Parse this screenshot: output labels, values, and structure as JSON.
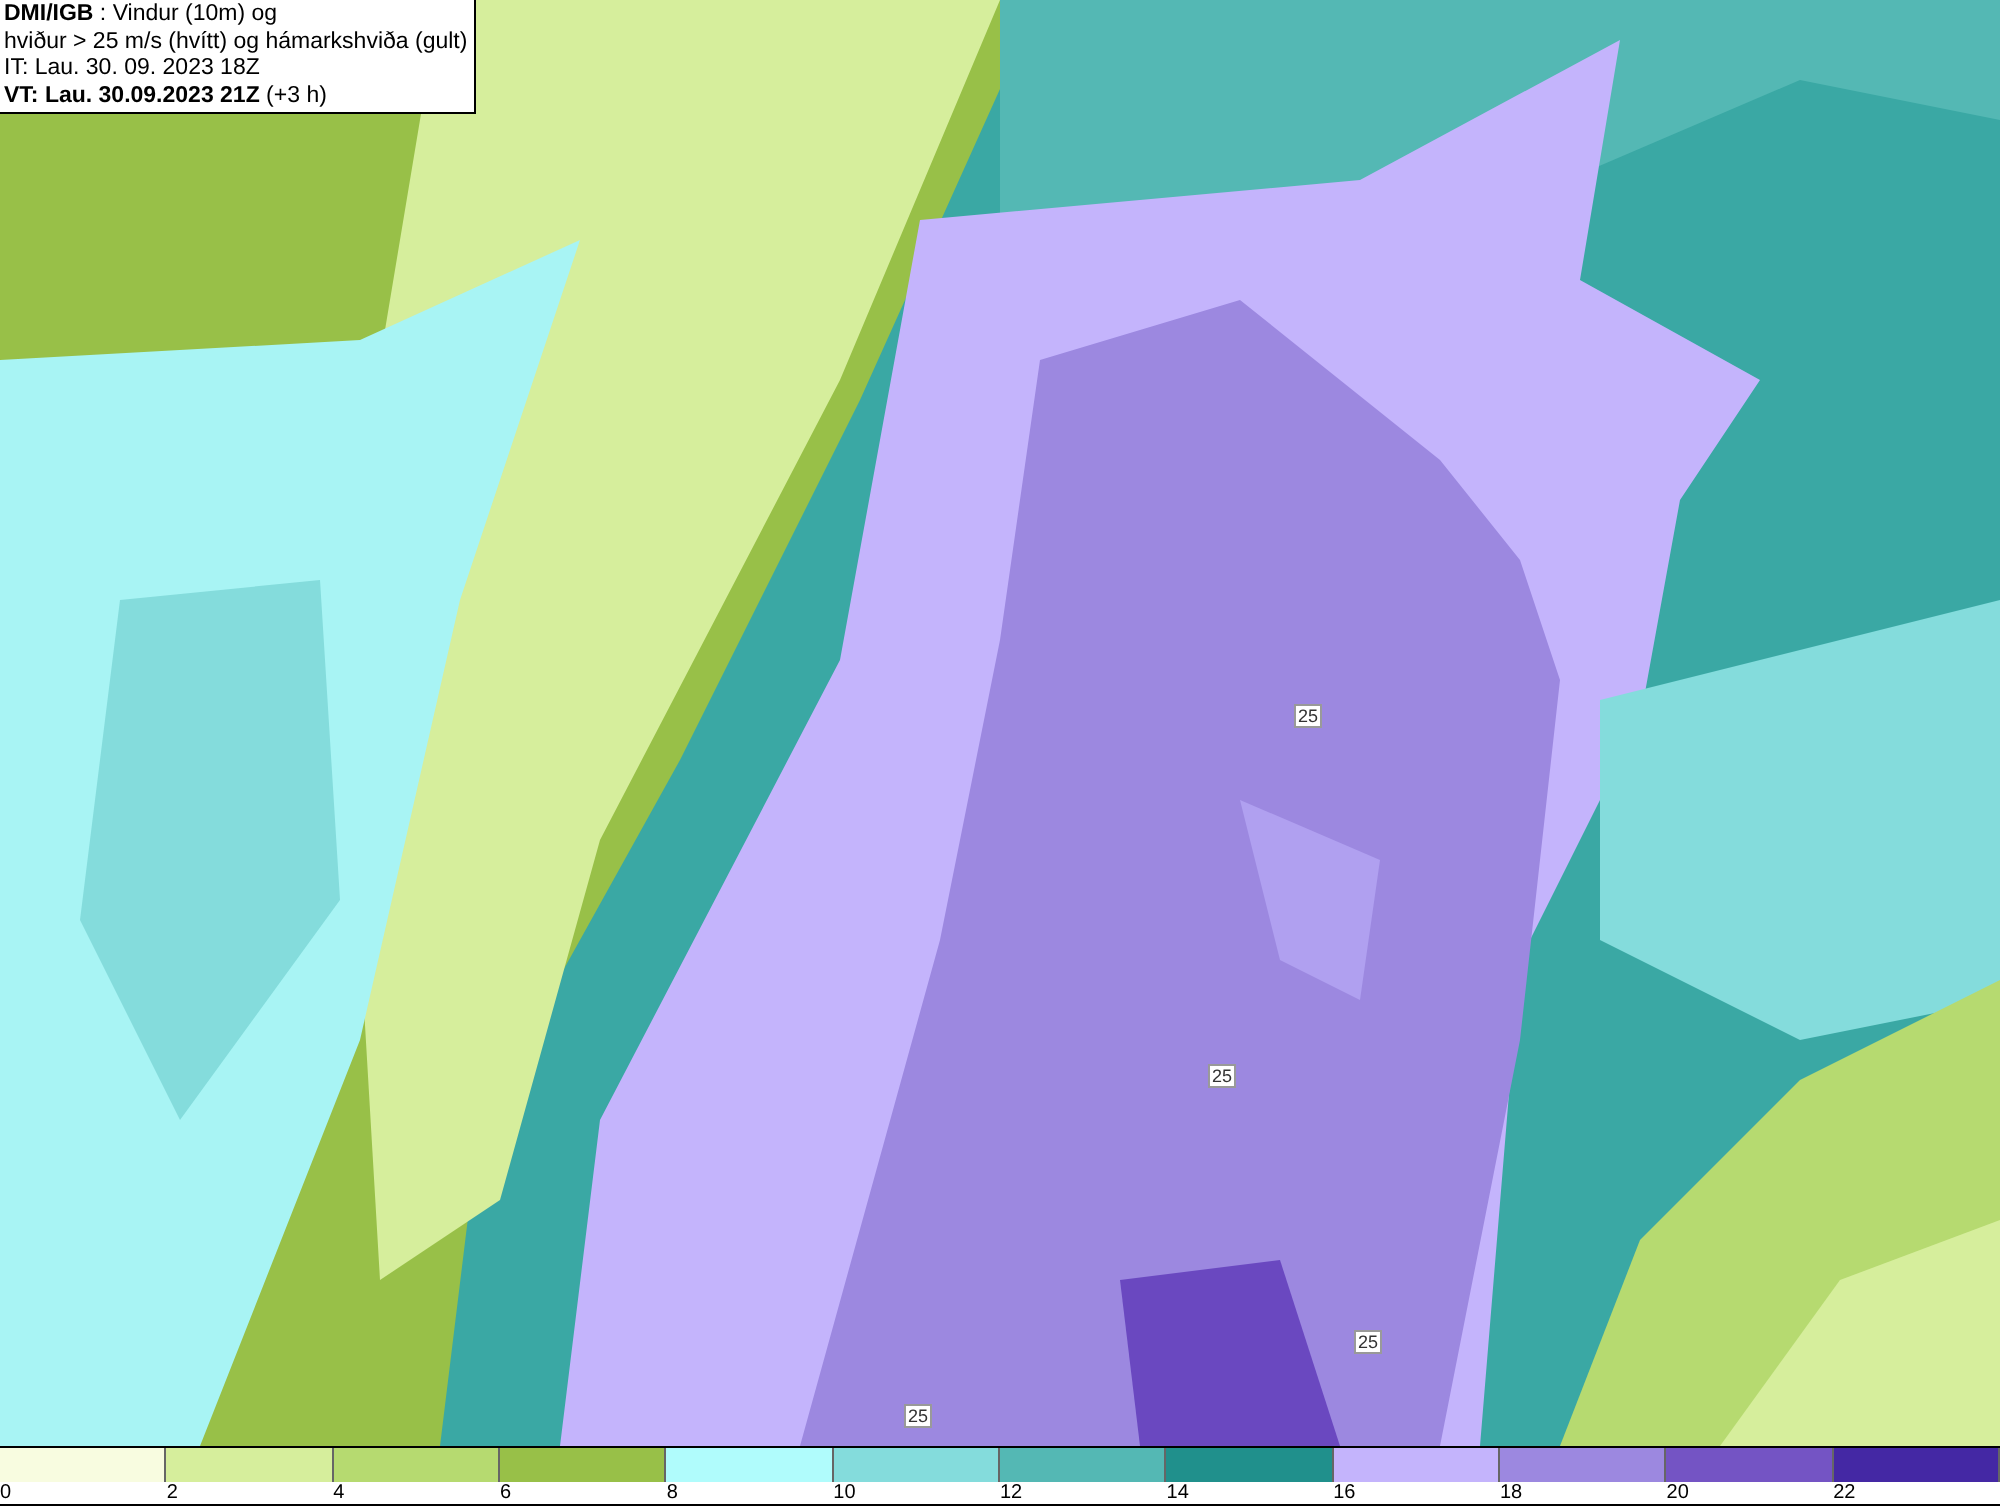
{
  "header": {
    "lines": [
      "**DMI/IGB** : Vindur (10m) og",
      "hviður > 25 m/s (hvítt) og hámarkshviða (gult)",
      "IT: Lau. 30. 09. 2023 18Z",
      "**VT: Lau. 30.09.2023 21Z** (+3 h)"
    ]
  },
  "map": {
    "contour_labels": [
      "25",
      "25",
      "25",
      "25"
    ]
  },
  "legend": {
    "bins": [
      {
        "color": "#f8fce0"
      },
      {
        "color": "#d6ee9c"
      },
      {
        "color": "#b6da70"
      },
      {
        "color": "#98c048"
      },
      {
        "color": "#b0fcfc"
      },
      {
        "color": "#84dcdc"
      },
      {
        "color": "#54b8b4"
      },
      {
        "color": "#20908c"
      },
      {
        "color": "#c4b4fc"
      },
      {
        "color": "#9c88e0"
      },
      {
        "color": "#7454c4"
      },
      {
        "color": "#4428a4"
      }
    ],
    "ticks": [
      "0",
      "2",
      "4",
      "6",
      "8",
      "10",
      "12",
      "14",
      "16",
      "18",
      "20",
      "22"
    ]
  }
}
